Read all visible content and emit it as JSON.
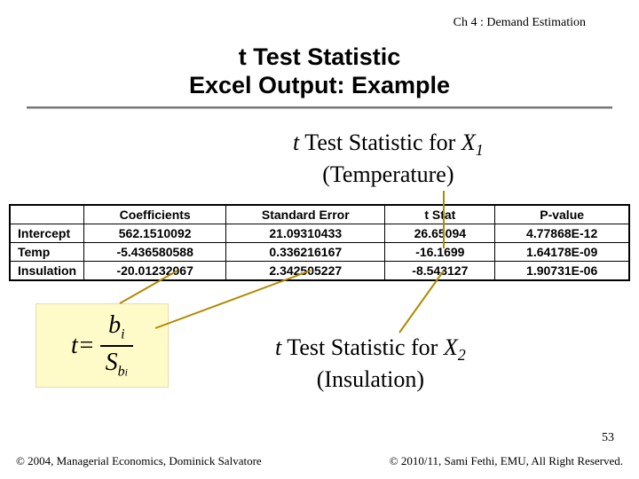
{
  "chapter": "Ch 4 : Demand Estimation",
  "title_line1": "t Test Statistic",
  "title_line2": "Excel Output: Example",
  "sub1_prefix_it": "t",
  "sub1_rest": " Test Statistic for ",
  "sub1_var": "X",
  "sub1_idx": "1",
  "sub1_paren": "(Temperature)",
  "sub2_prefix_it": "t",
  "sub2_rest": " Test Statistic for ",
  "sub2_var": "X",
  "sub2_idx": "2",
  "sub2_paren": "(Insulation)",
  "table": {
    "headers": [
      "",
      "Coefficients",
      "Standard Error",
      "t Stat",
      "P-value"
    ],
    "rows": [
      [
        "Intercept",
        "562.1510092",
        "21.09310433",
        "26.65094",
        "4.77868E-12"
      ],
      [
        "Temp",
        "-5.436580588",
        "0.336216167",
        "-16.1699",
        "1.64178E-09"
      ],
      [
        "Insulation",
        "-20.01232067",
        "2.342505227",
        "-8.543127",
        "1.90731E-06"
      ]
    ]
  },
  "formula": {
    "lhs": "t",
    "eq": " = ",
    "num_sym": "b",
    "num_sub": "i",
    "den_sym": "S",
    "den_sub1": "b",
    "den_sub2": "i"
  },
  "slide_number": "53",
  "footer_left": "© 2004,  Managerial Economics, Dominick Salvatore",
  "footer_right": "© 2010/11, Sami Fethi, EMU, All Right Reserved."
}
